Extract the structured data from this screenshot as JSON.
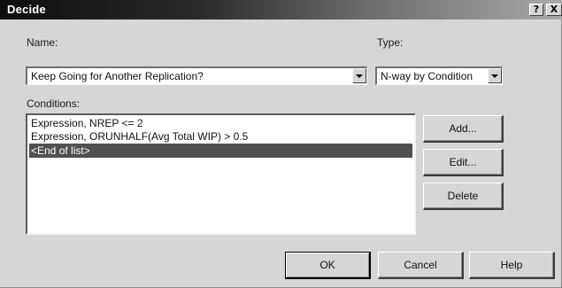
{
  "window": {
    "title": "Decide",
    "help_button": "?",
    "close_button": "X"
  },
  "name": {
    "label": "Name:",
    "value": "Keep Going for Another Replication?"
  },
  "type": {
    "label": "Type:",
    "value": "N-way by Condition"
  },
  "conditions": {
    "label": "Conditions:",
    "items": [
      "Expression, NREP <= 2",
      "Expression, ORUNHALF(Avg Total WIP) > 0.5",
      "<End of list>"
    ],
    "selected_index": 2
  },
  "side_buttons": {
    "add": "Add...",
    "edit": "Edit...",
    "delete": "Delete"
  },
  "bottom_buttons": {
    "ok": "OK",
    "cancel": "Cancel",
    "help": "Help"
  },
  "icons": {
    "dropdown": "chevron-down-icon"
  }
}
